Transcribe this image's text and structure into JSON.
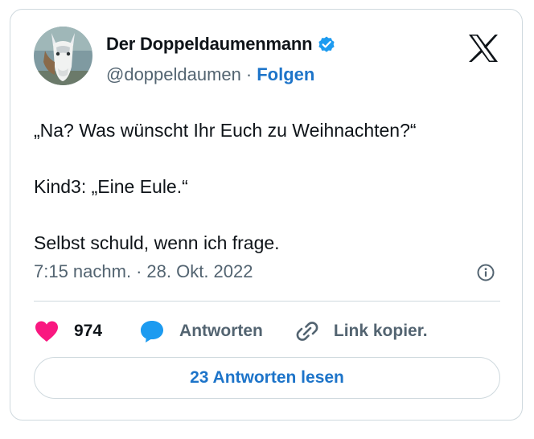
{
  "author": {
    "name": "Der Doppeldaumenmann",
    "handle": "@doppeldaumen",
    "separator": "·",
    "follow_label": "Folgen"
  },
  "icons": {
    "brand": "x-logo-icon",
    "verified": "verified-badge-icon",
    "info": "info-icon",
    "like": "heart-icon",
    "reply": "speech-bubble-icon",
    "copy": "link-icon"
  },
  "tweet": {
    "lines": [
      "„Na? Was wünscht Ihr Euch zu Weihnachten?“",
      "Kind3: „Eine Eule.“",
      "Selbst schuld, wenn ich frage."
    ],
    "time": "7:15 nachm.",
    "separator": "·",
    "date": "28. Okt. 2022"
  },
  "actions": {
    "like_count": "974",
    "reply_label": "Antworten",
    "copy_label": "Link kopier."
  },
  "read_replies_label": "23 Antworten lesen",
  "colors": {
    "accent": "#1d74c9",
    "heart": "#f91880",
    "verified": "#1d9bf0",
    "muted": "#536471",
    "border": "#cfd9de"
  }
}
